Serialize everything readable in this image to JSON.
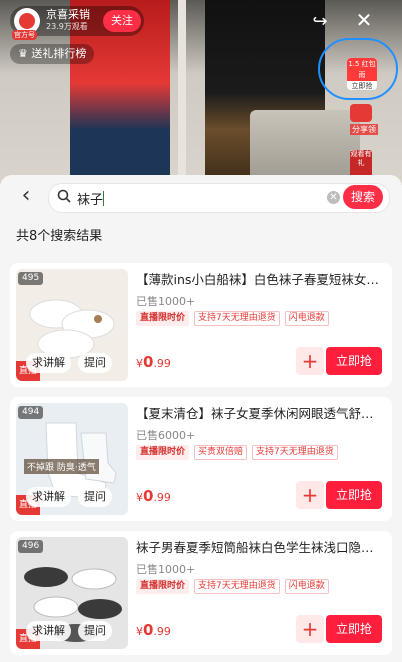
{
  "live": {
    "anchor_name": "京喜采销",
    "viewers": "23.9万观看",
    "avatar_tag": "官方号",
    "follow_label": "关注",
    "gift_rank_label": "送礼排行榜",
    "promo_top": "1.5 红包雨",
    "promo_bottom": "立即抢",
    "share_label": "分享领",
    "watch_label": "观看有礼"
  },
  "search": {
    "query": "袜子",
    "button_label": "搜索"
  },
  "results": {
    "count_text": "共8个搜索结果",
    "items": [
      {
        "index": "495",
        "title": "【薄款ins小白船袜】白色袜子春夏短袜女士纯棉...",
        "sold": "已售1000+",
        "tags": [
          "直播限时价",
          "支持7天无理由退货",
          "闪电退款"
        ],
        "price_symbol": "¥",
        "price_int": "0",
        "price_dec": ".99",
        "explain": "求讲解",
        "ask": "提问",
        "buy": "立即抢",
        "badge": "直播",
        "img_colors": [
          "#f2eee7",
          "#d8d2c6"
        ]
      },
      {
        "index": "494",
        "title": "【夏末清仓】袜子女夏季休闲网眼透气舒适...",
        "sold": "已售6000+",
        "tags": [
          "直播限时价",
          "买贵双倍赔",
          "支持7天无理由退货"
        ],
        "price_symbol": "¥",
        "price_int": "0",
        "price_dec": ".99",
        "explain": "求讲解",
        "ask": "提问",
        "buy": "立即抢",
        "badge": "直播",
        "overlay": "不掉跟 防臭·透气",
        "img_colors": [
          "#e9eef3",
          "#c7cfd8"
        ]
      },
      {
        "index": "496",
        "title": "袜子男春夏季短筒船袜白色学生袜浅口隐形...",
        "sold": "已售1000+",
        "tags": [
          "直播限时价",
          "支持7天无理由退货",
          "闪电退款"
        ],
        "price_symbol": "¥",
        "price_int": "0",
        "price_dec": ".99",
        "explain": "求讲解",
        "ask": "提问",
        "buy": "立即抢",
        "badge": "直播",
        "img_colors": [
          "#e5e5e5",
          "#3a3a3a"
        ]
      }
    ]
  }
}
